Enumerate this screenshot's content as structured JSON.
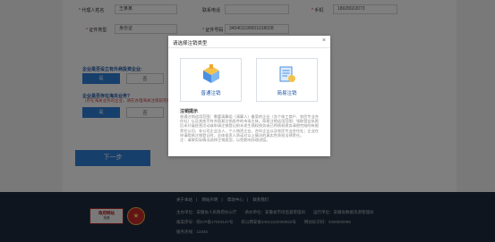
{
  "form": {
    "agent_label": "代理人姓名",
    "agent_value": "王某某",
    "contact_label": "联系电话",
    "contact_value": "",
    "phone_label": "手机",
    "phone_value": "18928022073",
    "id_type_label": "证件类型",
    "id_type_value": "身份证",
    "id_no_label": "证件号码",
    "id_no_value": "340401199001018028"
  },
  "questions": {
    "q1": "企业是否设立有外商投资企业:",
    "q2": "企业是否存在海关业务?",
    "q2_sub": "（存在海关业务的企业，请在办理海关注销前完成相关业务办理后再办理注销。）",
    "yes_label": "是",
    "no_label": "否"
  },
  "next_button": "下一步",
  "footer": {
    "links": [
      "关于本站",
      "|",
      "网站声明",
      "|",
      "帮助中心",
      "|",
      "联系我们"
    ],
    "line1": "主办单位：安徽省人民政府办公厅　　承办单位：安徽省市场监督管理局　　运行单位：安徽省数据资源管理局",
    "line2": "备案序号：皖ICP备17023147号　　皖公网安备34011102000822号　　网站标识码：3400000066",
    "line3": "服务热线：12345",
    "logo1_top": "政府网站",
    "logo1_bottom": "找错",
    "logo2_glyph": "★"
  },
  "modal": {
    "title": "请选择注销类型",
    "close": "×",
    "option1": "普通注销",
    "option2": "简易注销",
    "info_title": "注销提示",
    "info_text": "普通注销适用范围：需要清算组（清算人）备案的企业（含个体工商户、农民专业合作社）以及其他不符合简易注销条件的市场主体。简易注销适用范围：领取营业执照后未开展经营活动或申请注销登记前未发生债权债务或已将债权债务清偿完结的有限责任公司、非公司企业法人、个人独资企业、合伙企业以及农民专业合作社；企业在申请简易注销登记时，全体投资人承诺对以上情况的真实性承担法律责任。",
    "info_note": "注：请按实际情况选择注销类型，以免影响办理进度。"
  }
}
